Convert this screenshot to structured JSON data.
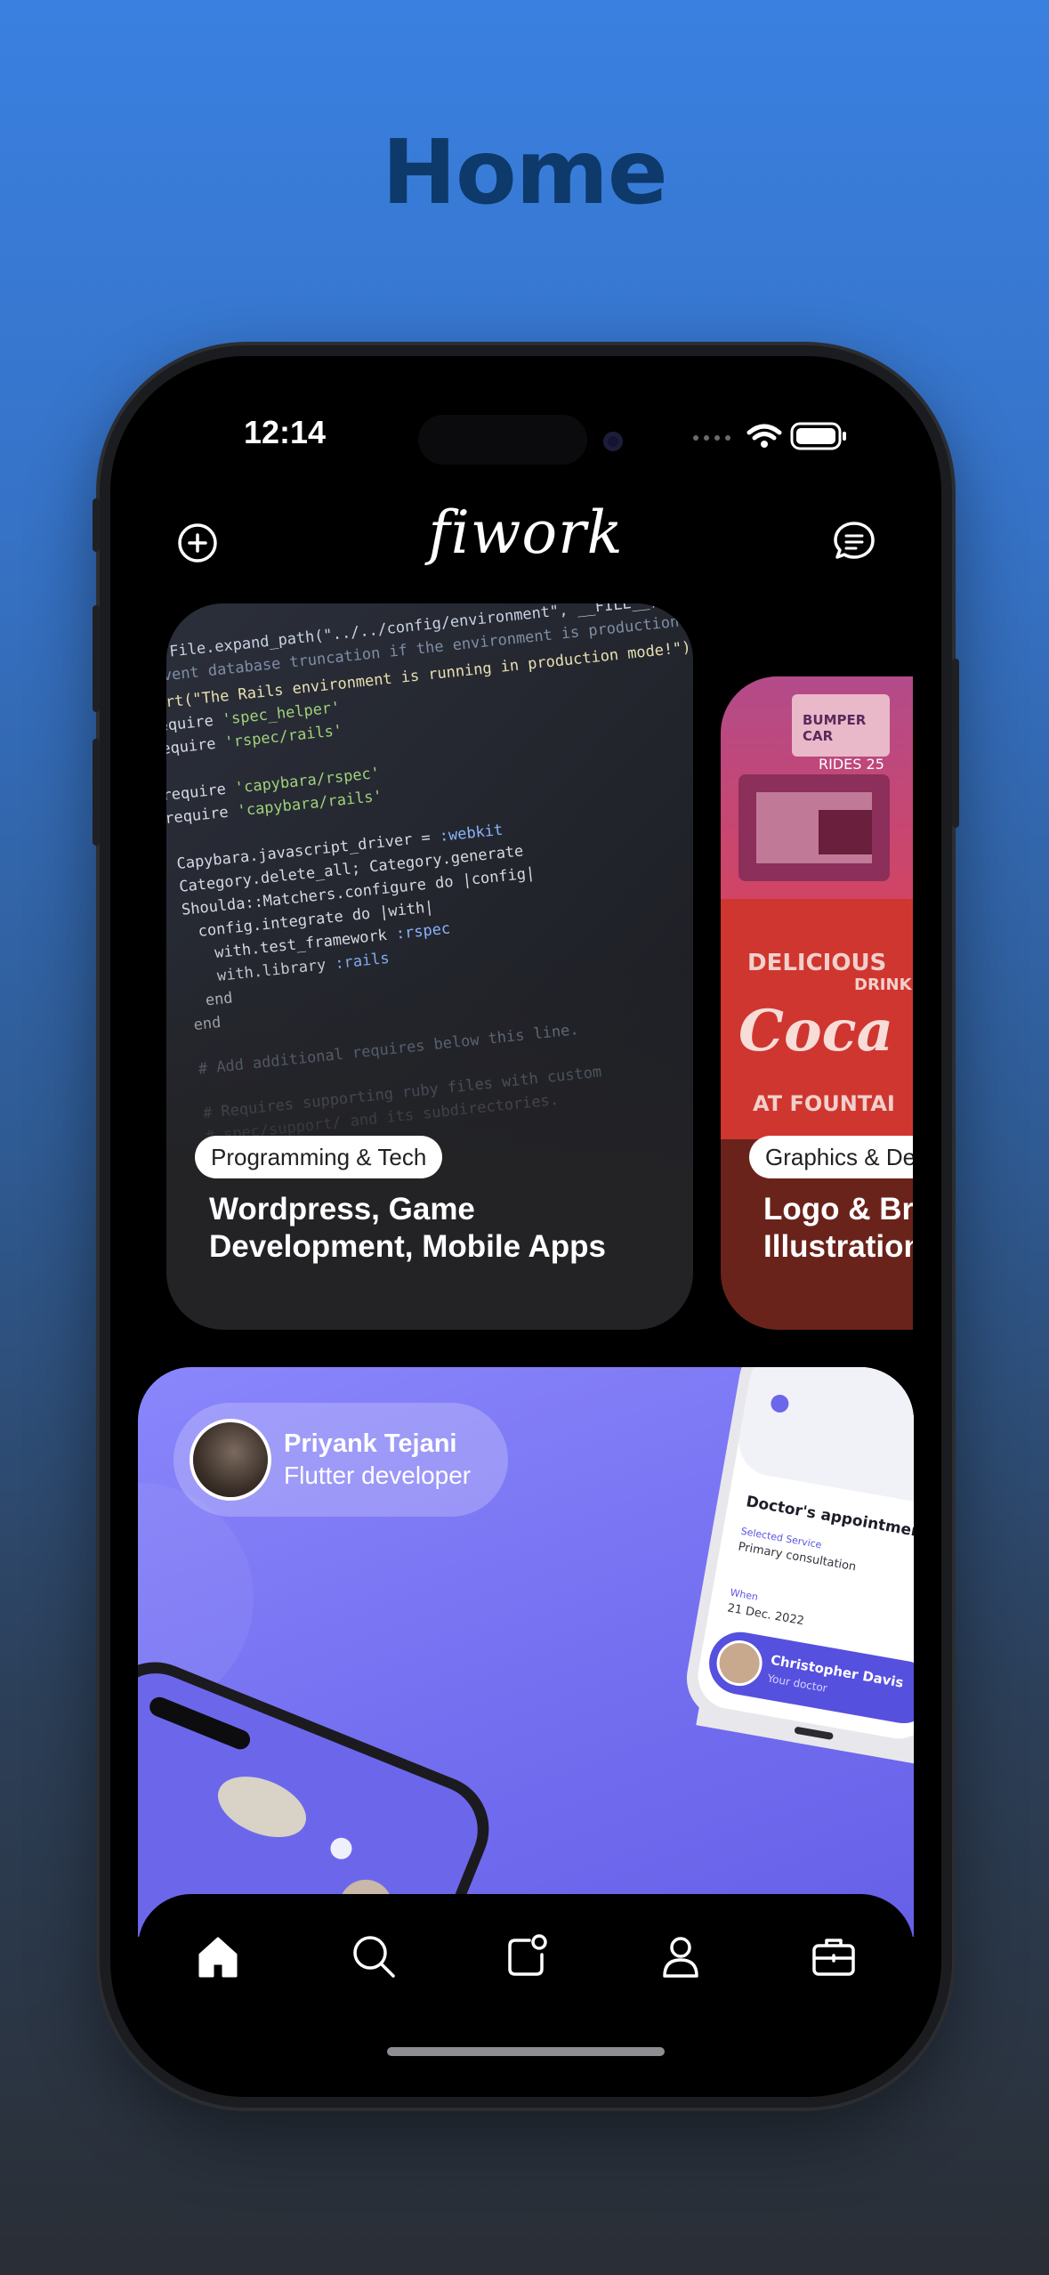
{
  "page": {
    "heading": "Home"
  },
  "status_bar": {
    "time": "12:14",
    "icons": [
      "signal-dots-icon",
      "wifi-icon",
      "battery-icon"
    ]
  },
  "header": {
    "logo_text": "fiwork",
    "left_icon": "add-circle-icon",
    "right_icon": "chat-bubble-icon"
  },
  "categories": [
    {
      "tag": "Programming & Tech",
      "title": "Wordpress, Game\nDevelopment, Mobile Apps"
    },
    {
      "tag": "Graphics & Design",
      "title": "Logo & Brand\nIllustration"
    }
  ],
  "promo": {
    "user_name": "Priyank Tejani",
    "user_role": "Flutter developer",
    "mockup_title": "Doctor's appointment number",
    "mockup_selected_label": "Selected Service",
    "mockup_service": "Primary consultation",
    "mockup_when_label": "When",
    "mockup_date": "21 Dec. 2022",
    "mockup_doctor": "Christopher Davis",
    "mockup_doctor_role": "Your doctor"
  },
  "tab_bar": [
    {
      "name": "home",
      "icon": "home-icon",
      "active": true
    },
    {
      "name": "search",
      "icon": "search-icon",
      "active": false
    },
    {
      "name": "notifications",
      "icon": "notification-square-icon",
      "active": false
    },
    {
      "name": "profile",
      "icon": "user-icon",
      "active": false
    },
    {
      "name": "jobs",
      "icon": "briefcase-icon",
      "active": false
    }
  ],
  "colors": {
    "background_top": "#3a80e0",
    "background_bottom": "#2a2e35",
    "heading": "#0d3a6b",
    "promo": "#746ff0",
    "card_dark": "#232326",
    "card_red": "#6a231a"
  }
}
